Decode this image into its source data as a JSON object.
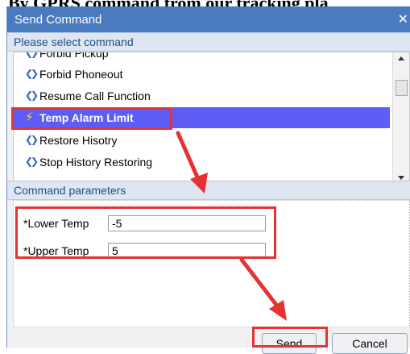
{
  "page": {
    "heading": "By GPRS command from our tracking pla"
  },
  "dialog": {
    "title": "Send Command",
    "close_icon": "close-icon",
    "select_section_label": "Please select command",
    "params_section_label": "Command parameters"
  },
  "commands": {
    "partial_label": "Forbid Pickup",
    "items": [
      {
        "label": "Forbid Phoneout",
        "icon": "double-arrow-icon"
      },
      {
        "label": "Resume Call Function",
        "icon": "double-arrow-icon"
      },
      {
        "label": "Temp Alarm Limit",
        "icon": "lightning-bolt-icon",
        "selected": true
      },
      {
        "label": "Restore Hisotry",
        "icon": "double-arrow-icon"
      },
      {
        "label": "Stop History Restoring",
        "icon": "double-arrow-icon"
      }
    ]
  },
  "params": {
    "lower_label": "*Lower Temp",
    "lower_value": "-5",
    "upper_label": "*Upper Temp",
    "upper_value": "5"
  },
  "buttons": {
    "send": "Send",
    "cancel": "Cancel"
  },
  "colors": {
    "titlebar": "#4a7ac0",
    "selection": "#5d5df5",
    "annotation": "#e53333"
  }
}
